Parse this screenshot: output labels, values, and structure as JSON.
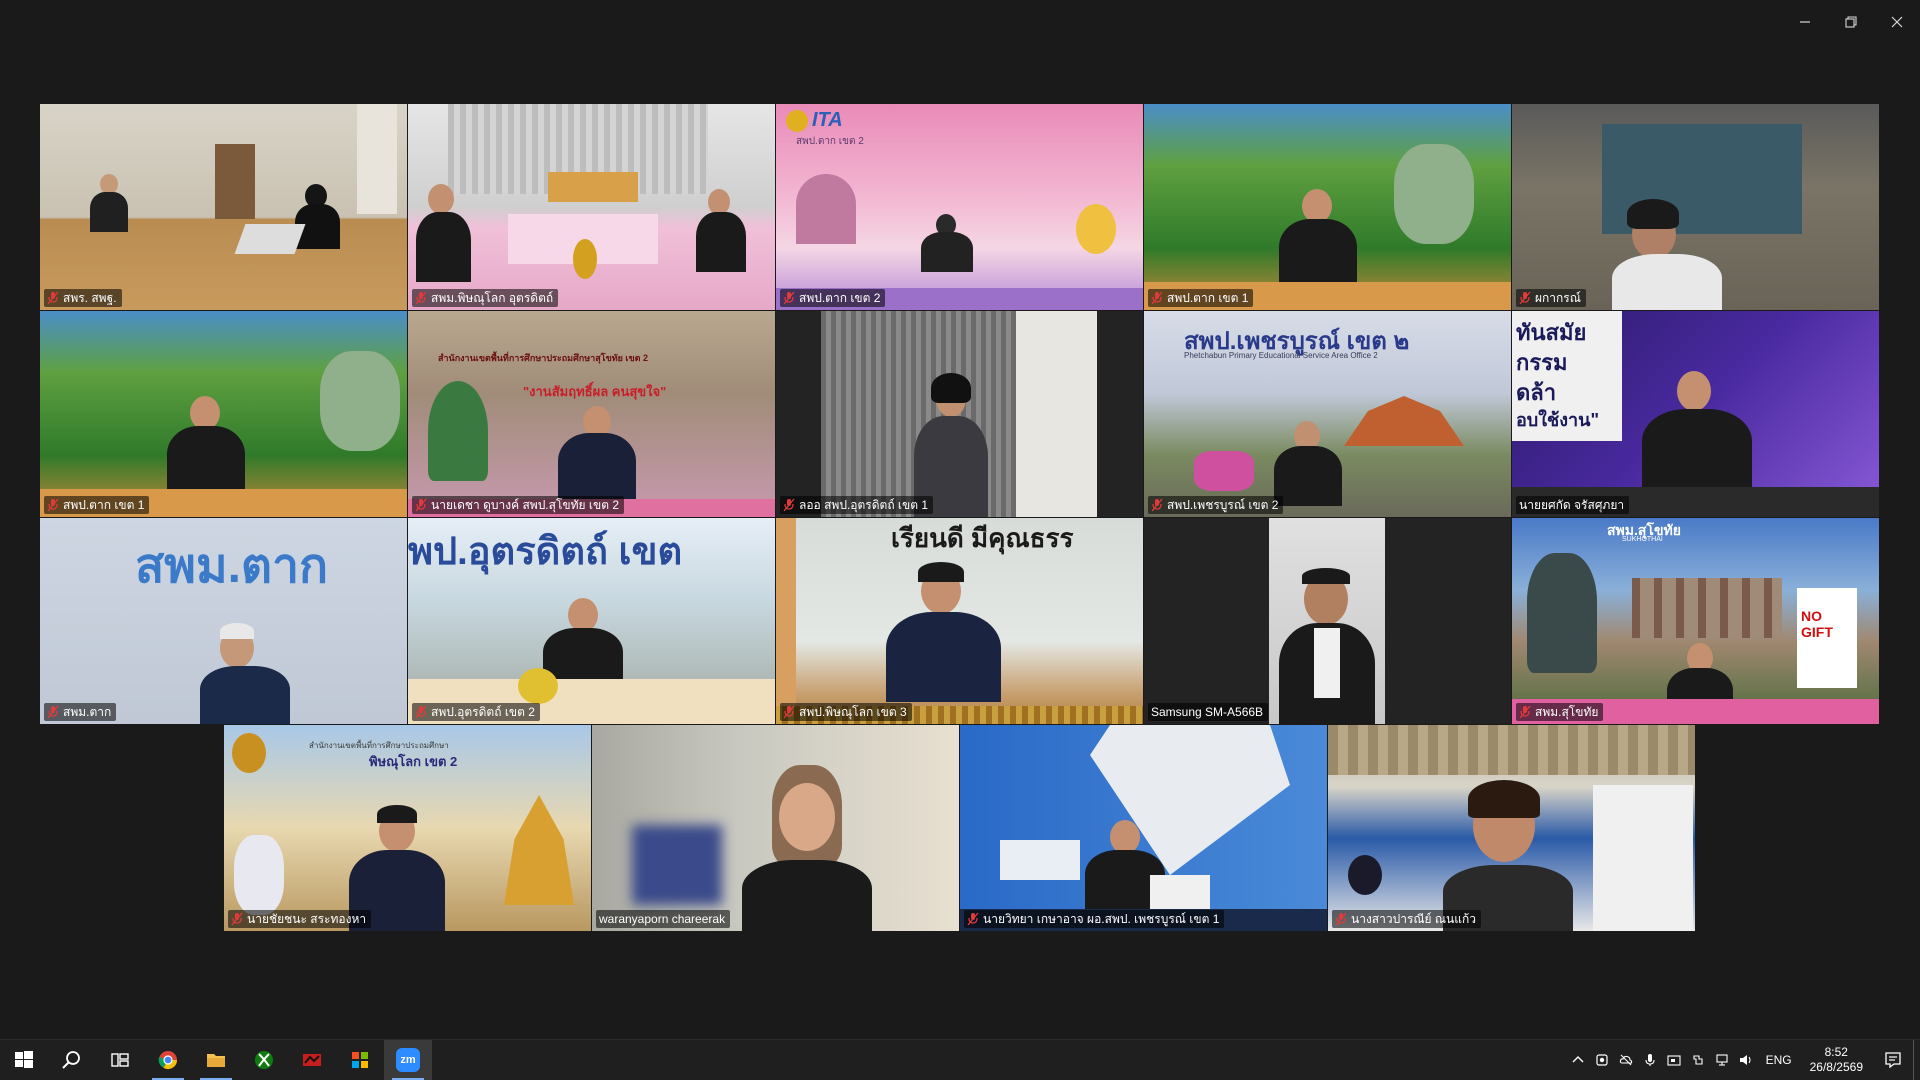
{
  "window": {
    "controls": [
      "minimize",
      "restore",
      "close"
    ]
  },
  "tiles": [
    {
      "name": "สพร. สพฐ.",
      "mic_muted": true
    },
    {
      "name": "สพม.พิษณุโลก อุตรดิตถ์",
      "mic_muted": true
    },
    {
      "name": "สพป.ตาก เขต 2",
      "mic_muted": true
    },
    {
      "name": "สพป.ตาก เขต 1",
      "mic_muted": true
    },
    {
      "name": "ผกากรณ์",
      "mic_muted": true
    },
    {
      "name": "สพป.ตาก เขต 1",
      "mic_muted": true
    },
    {
      "name": "นายเดชา ดูบางค์ สพป.สุโขทัย เขต 2",
      "mic_muted": true
    },
    {
      "name": "ลออ สพป.อุตรดิตถ์ เขต 1",
      "mic_muted": true
    },
    {
      "name": "สพป.เพชรบูรณ์ เขต 2",
      "mic_muted": true
    },
    {
      "name": "นายยศกัด จรัสศุภยา",
      "mic_muted": false
    },
    {
      "name": "สพม.ตาก",
      "mic_muted": true
    },
    {
      "name": "สพป.อุตรดิตถ์ เขต 2",
      "mic_muted": true
    },
    {
      "name": "สพป.พิษณุโลก เขต 3",
      "mic_muted": true
    },
    {
      "name": "Samsung SM-A566B",
      "mic_muted": false
    },
    {
      "name": "สพม.สุโขทัย",
      "mic_muted": true
    },
    {
      "name": "นายชัยชนะ สระทองหา",
      "mic_muted": true
    },
    {
      "name": "waranyaporn chareerak",
      "mic_muted": false,
      "active_speaker": true
    },
    {
      "name": "นายวิทยา เกษาอาจ ผอ.สพป. เพชรบูรณ์ เขต 1",
      "mic_muted": true
    },
    {
      "name": "นางสาวปารณีย์ ณนแก้ว",
      "mic_muted": true
    }
  ],
  "banners": {
    "ita_logo": "ITA",
    "ita_sub": "สพป.ตาก เขต 2",
    "sukhothai2_title": "สำนักงานเขตพื้นที่การศึกษาประถมศึกษาสุโขทัย เขต 2",
    "sukhothai2_slogan": "\"งานสัมฤทธิ์ผล คนสุขใจ\"",
    "phetchabun2_title": "สพป.เพชรบูรณ์ เขต ๒",
    "phetchabun2_sub": "Phetchabun Primary Educational Service Area Office 2",
    "tile10_words": [
      "ทันสมัย",
      "กรรม",
      "ดล้า",
      "อบใช้งาน\""
    ],
    "tak_sec": "สพม.ตาก",
    "uttaradit2": "พป.อุตรดิตถ์ เขต",
    "phitsanulok3": "เรียนดี มีคุณธรร",
    "sukhothai_sec": "สพม.สุโขทัย",
    "sukhothai_sec_en": "SUKHOTHAI",
    "no_gift": "NO GIFT",
    "phitsanulok2_title": "สำนักงานเขตพื้นที่การศึกษาประถมศึกษา",
    "phitsanulok2_name": "พิษณุโลก เขต 2"
  },
  "taskbar": {
    "apps": [
      "start-icon",
      "search-icon",
      "task-view-icon",
      "chrome-icon",
      "file-explorer-icon",
      "xbox-icon",
      "red-app-icon",
      "store-icon",
      "zoom-icon"
    ],
    "zoom_label": "zm",
    "language": "ENG",
    "time": "8:52",
    "date": "26/8/2569"
  },
  "colors": {
    "active_speaker_border": "#2fd38b",
    "muted_mic": "#e23a3a",
    "taskbar_bg": "#1f1f1f"
  }
}
